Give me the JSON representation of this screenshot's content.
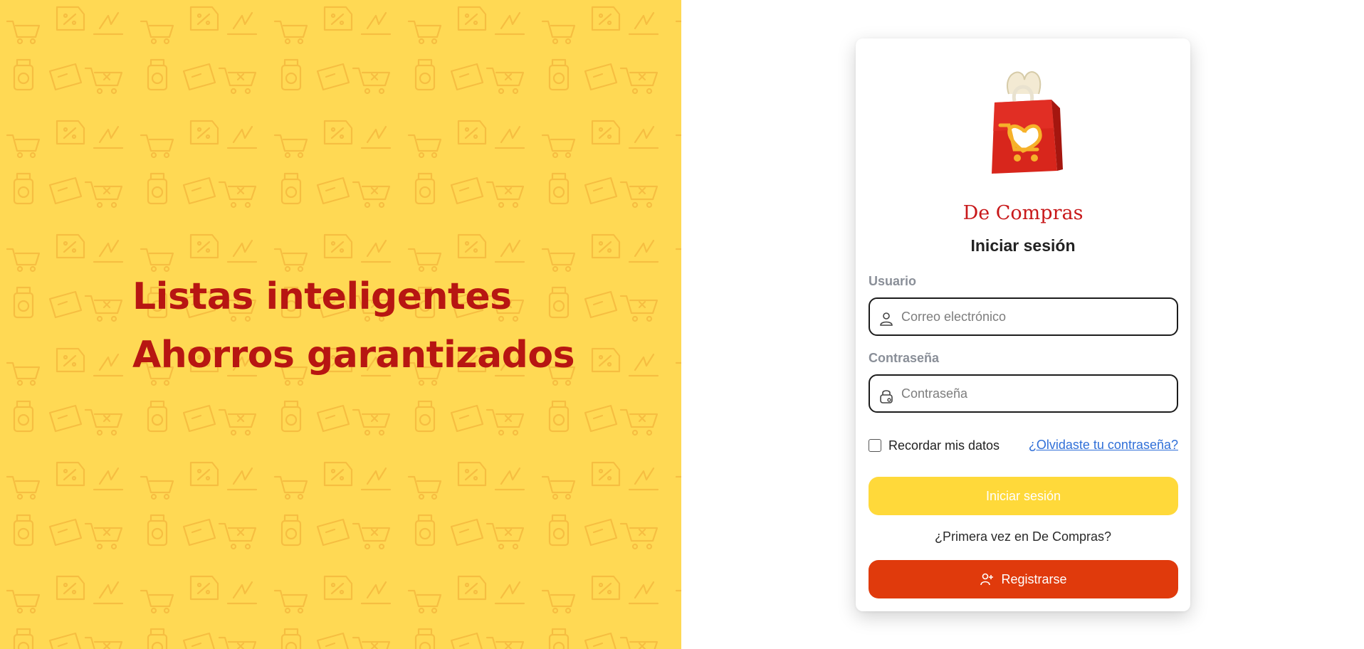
{
  "hero": {
    "taglines": [
      "Listas inteligentes",
      "Ahorros garantizados"
    ],
    "background_color": "#ffd954",
    "text_color": "#b71612"
  },
  "login_card": {
    "brand_name": "De Compras",
    "title": "Iniciar sesión",
    "username": {
      "label": "Usuario",
      "placeholder": "Correo electrónico",
      "value": ""
    },
    "password": {
      "label": "Contraseña",
      "placeholder": "Contraseña",
      "value": ""
    },
    "remember_label": "Recordar mis datos",
    "remember_checked": false,
    "forgot_link": "¿Olvidaste tu contraseña?",
    "login_button": "Iniciar sesión",
    "first_time_text": "¿Primera vez en De Compras?",
    "register_button": "Registrarse",
    "colors": {
      "login_button": "#ffd93a",
      "register_button": "#e03a0c",
      "link": "#2f6fd8",
      "brand": "#c8181a"
    },
    "icons": {
      "username": "user-icon",
      "password": "lock-icon",
      "register": "user-plus-icon"
    }
  }
}
